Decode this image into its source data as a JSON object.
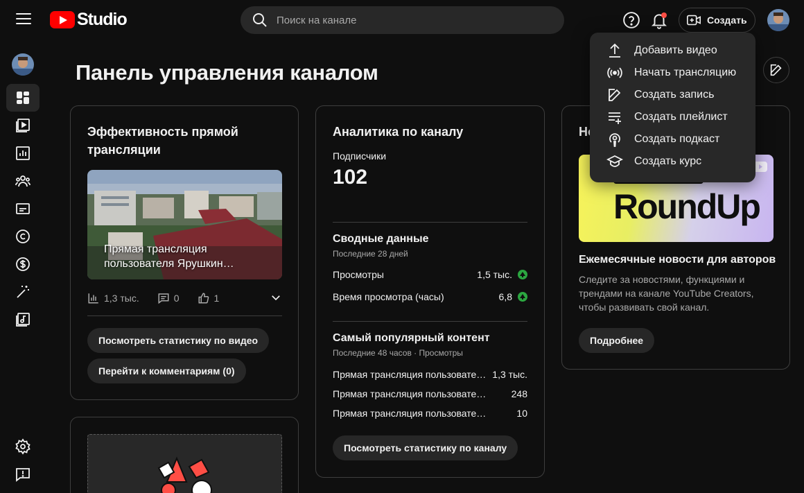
{
  "header": {
    "logo_text": "Studio",
    "search_placeholder": "Поиск на канале",
    "create_label": "Создать"
  },
  "page": {
    "title": "Панель управления каналом"
  },
  "live_card": {
    "title": "Эффективность прямой трансляции",
    "video_title": "Прямая трансляция пользователя Ярушкин…",
    "views": "1,3 тыс.",
    "comments": "0",
    "likes": "1",
    "btn_stats": "Посмотреть статистику по видео",
    "btn_comments": "Перейти к комментариям (0)"
  },
  "analytics": {
    "title": "Аналитика по каналу",
    "subscribers_label": "Подписчики",
    "subscribers_value": "102",
    "summary_title": "Сводные данные",
    "summary_sub": "Последние 28 дней",
    "metrics": [
      {
        "name": "Просмотры",
        "value": "1,5 тыс."
      },
      {
        "name": "Время просмотра (часы)",
        "value": "6,8"
      }
    ],
    "top_title": "Самый популярный контент",
    "top_sub": "Последние 48 часов · Просмотры",
    "top_items": [
      {
        "name": "Прямая трансляция пользовате…",
        "value": "1,3 тыс."
      },
      {
        "name": "Прямая трансляция пользовате…",
        "value": "248"
      },
      {
        "name": "Прямая трансляция пользовате…",
        "value": "10"
      }
    ],
    "btn_channel_stats": "Посмотреть статистику по каналу"
  },
  "news": {
    "title_partial": "Но",
    "banner_text": "RoundUp",
    "headline": "Ежемесячные новости для авторов",
    "description": "Следите за новостями, функциями и трендами на канале YouTube Creators, чтобы развивать свой канал.",
    "btn_more": "Подробнее"
  },
  "create_menu": {
    "items": [
      {
        "label": "Добавить видео",
        "icon": "upload-icon"
      },
      {
        "label": "Начать трансляцию",
        "icon": "live-icon"
      },
      {
        "label": "Создать запись",
        "icon": "post-icon"
      },
      {
        "label": "Создать плейлист",
        "icon": "playlist-icon"
      },
      {
        "label": "Создать подкаст",
        "icon": "podcast-icon"
      },
      {
        "label": "Создать курс",
        "icon": "course-icon"
      }
    ]
  },
  "sidebar": {
    "items": [
      "dashboard-icon",
      "content-icon",
      "analytics-icon",
      "community-icon",
      "subtitles-icon",
      "copyright-icon",
      "earn-icon",
      "customization-icon",
      "audio-library-icon",
      "settings-icon",
      "feedback-icon"
    ]
  },
  "colors": {
    "accent_red": "#ff0000",
    "background": "#0f0f0f",
    "surface": "#282828",
    "positive": "#2ba640"
  }
}
